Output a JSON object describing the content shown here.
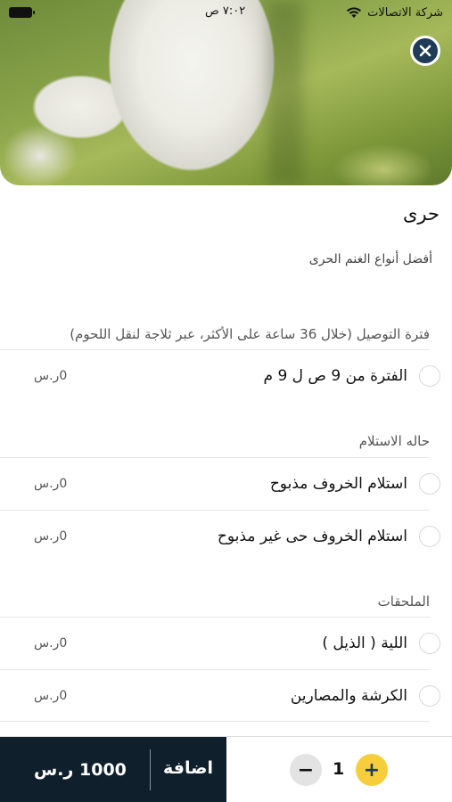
{
  "status_bar": {
    "carrier": "شركة الاتصالات",
    "time": "٧:٠٢ ص"
  },
  "icons": {
    "close": "close-icon",
    "wifi": "wifi-icon",
    "battery": "battery-icon",
    "plus": "plus-icon",
    "minus": "minus-icon"
  },
  "product": {
    "name": "حرى",
    "description": "أفضل أنواع الغنم الحرى"
  },
  "sections": [
    {
      "title": "فترة التوصيل (خلال 36 ساعة على الأكثر، عبر ثلاجة لنقل اللحوم)",
      "options": [
        {
          "label": "الفترة من 9 ص ل 9 م",
          "price": "0ر.س"
        }
      ]
    },
    {
      "title": "حاله الاستلام",
      "options": [
        {
          "label": "استلام الخروف مذبوح",
          "price": "0ر.س"
        },
        {
          "label": "استلام الخروف حى غير مذبوح",
          "price": "0ر.س"
        }
      ]
    },
    {
      "title": "الملحقات",
      "options": [
        {
          "label": "اللية ( الذيل )",
          "price": "0ر.س"
        },
        {
          "label": "الكرشة والمصارين",
          "price": "0ر.س"
        }
      ]
    }
  ],
  "cart": {
    "add_label": "اضافة",
    "total": "1000 ر.س",
    "quantity": "1",
    "minus": "−",
    "plus": "+"
  },
  "colors": {
    "dark": "#0f1f2b",
    "accent": "#f6cd3d",
    "close_bg": "#1f3b57"
  }
}
